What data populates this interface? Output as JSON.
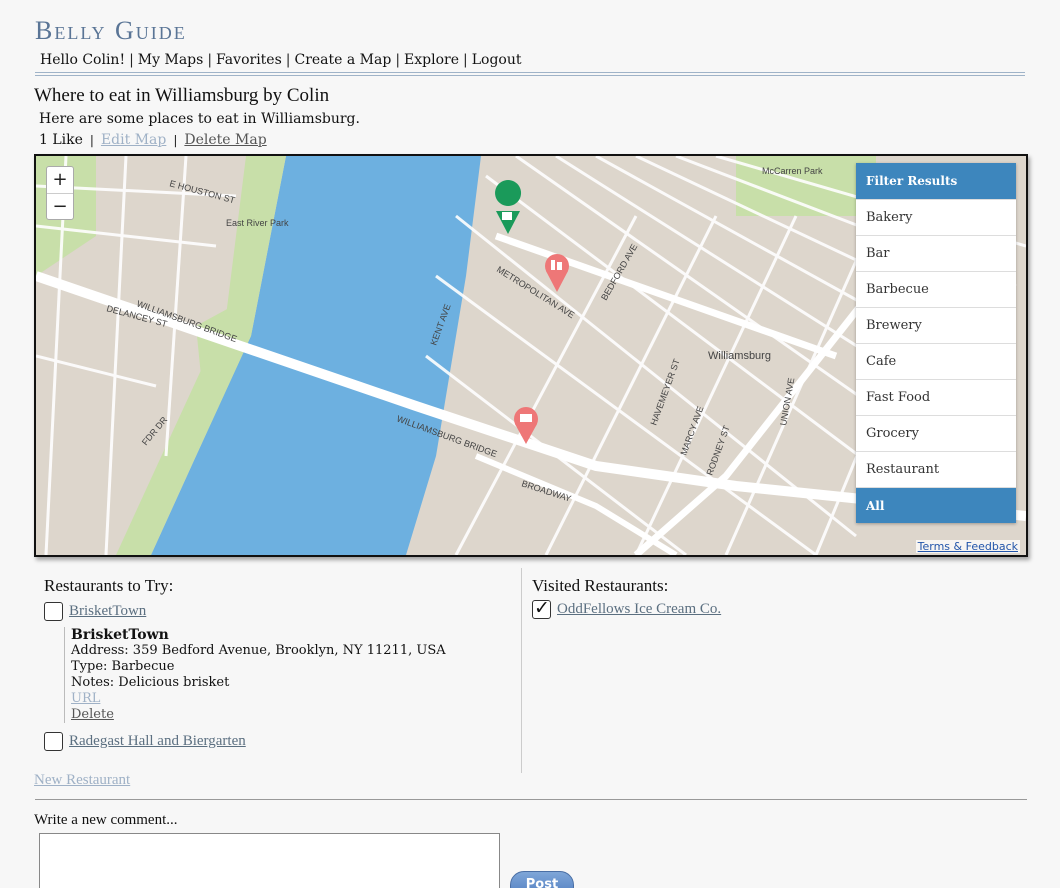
{
  "site": {
    "title": "Belly Guide"
  },
  "nav": [
    "Hello Colin!",
    "My Maps",
    "Favorites",
    "Create a Map",
    "Explore",
    "Logout"
  ],
  "map_info": {
    "title": "Where to eat in Williamsburg by Colin",
    "description": "Here are some places to eat in Williamsburg.",
    "likes": "1 Like",
    "edit_label": "Edit Map",
    "delete_label": "Delete Map"
  },
  "map": {
    "zoom_in": "+",
    "zoom_out": "−",
    "terms": "Terms & Feedback",
    "labels": {
      "east_river_park": "East River Park",
      "williamsburg": "Williamsburg",
      "williamsburg_bridge": "WILLIAMSBURG BRIDGE",
      "williamsburg_bridge2": "WILLIAMSBURG BRIDGE",
      "metropolitan": "METROPOLITAN AVE",
      "broadway": "BROADWAY",
      "kent": "KENT AVE",
      "bedford": "BEDFORD AVE",
      "e_houston": "E HOUSTON ST",
      "fdr": "FDR DR",
      "mccarren": "McCarren Park",
      "union": "UNION AVE",
      "havemeyer": "HAVEMEYER ST",
      "marcy": "MARCY AVE",
      "rodney": "RODNEY ST",
      "delancey": "DELANCEY ST"
    },
    "colors": {
      "water": "#6db0e0",
      "land": "#ddd6cc",
      "park": "#c8dfa9",
      "road": "#ffffff",
      "pin_green": "#1a9a5a",
      "pin_red": "#ee7777"
    },
    "filter": {
      "title": "Filter Results",
      "items": [
        "Bakery",
        "Bar",
        "Barbecue",
        "Brewery",
        "Cafe",
        "Fast Food",
        "Grocery",
        "Restaurant"
      ],
      "all_label": "All"
    }
  },
  "to_try": {
    "heading": "Restaurants to Try:",
    "items": [
      {
        "name": "BrisketTown",
        "checked": false
      },
      {
        "name": "Radegast Hall and Biergarten",
        "checked": false
      }
    ],
    "details": {
      "name": "BrisketTown",
      "address": "Address: 359 Bedford Avenue, Brooklyn, NY 11211, USA",
      "type": "Type: Barbecue",
      "notes": "Notes: Delicious brisket",
      "url_label": "URL",
      "delete_label": "Delete"
    }
  },
  "visited": {
    "heading": "Visited Restaurants:",
    "items": [
      {
        "name": "OddFellows Ice Cream Co.",
        "checked": true
      }
    ]
  },
  "new_restaurant": "New Restaurant",
  "comment": {
    "label": "Write a new comment...",
    "post_label": "Post"
  }
}
